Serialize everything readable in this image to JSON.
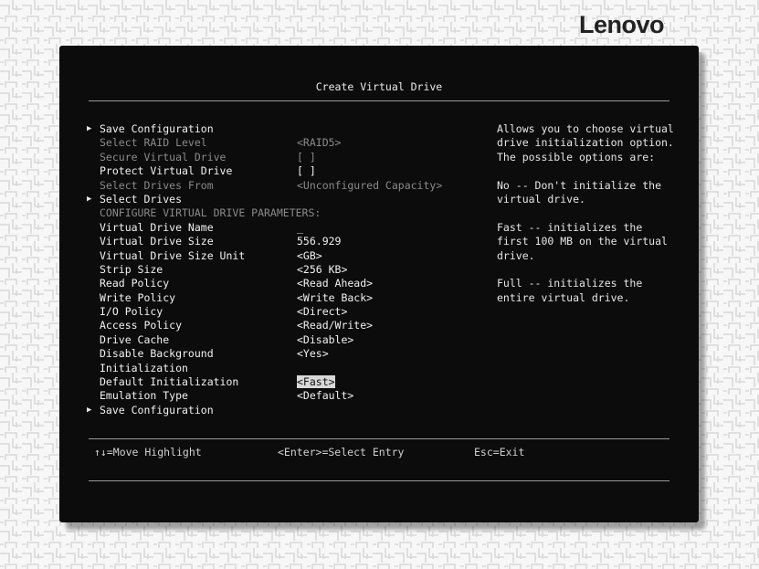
{
  "brand": "Lenovo",
  "title": "Create Virtual Drive",
  "rows": [
    {
      "label": "Save Configuration",
      "value": "",
      "arrow": true,
      "style": "bright"
    },
    {
      "label": "Select RAID Level",
      "value": "<RAID5>",
      "style": "dim"
    },
    {
      "label": "Secure Virtual Drive",
      "value": "[ ]",
      "style": "dim"
    },
    {
      "label": "Protect Virtual Drive",
      "value": "[ ]",
      "style": "bright"
    },
    {
      "label": "Select Drives From",
      "value": "<Unconfigured Capacity>",
      "style": "dim"
    },
    {
      "label": "Select Drives",
      "value": "",
      "arrow": true,
      "style": "bright"
    },
    {
      "label": "CONFIGURE VIRTUAL DRIVE PARAMETERS:",
      "value": "",
      "style": "dim"
    },
    {
      "label": "Virtual Drive Name",
      "value": "_",
      "style": "bright"
    },
    {
      "label": "Virtual Drive Size",
      "value": "556.929",
      "style": "bright"
    },
    {
      "label": "Virtual Drive Size Unit",
      "value": "<GB>",
      "style": "bright"
    },
    {
      "label": "Strip Size",
      "value": "<256 KB>",
      "style": "bright"
    },
    {
      "label": "Read Policy",
      "value": "<Read Ahead>",
      "style": "bright"
    },
    {
      "label": "Write Policy",
      "value": "<Write Back>",
      "style": "bright"
    },
    {
      "label": "I/O Policy",
      "value": "<Direct>",
      "style": "bright"
    },
    {
      "label": "Access Policy",
      "value": "<Read/Write>",
      "style": "bright"
    },
    {
      "label": "Drive Cache",
      "value": "<Disable>",
      "style": "bright"
    },
    {
      "label": "Disable Background",
      "value": "<Yes>",
      "style": "bright"
    },
    {
      "label": "Initialization",
      "value": "",
      "style": "bright"
    },
    {
      "label": "Default Initialization",
      "value": "<Fast>",
      "style": "bright",
      "highlight": true
    },
    {
      "label": "Emulation Type",
      "value": "<Default>",
      "style": "bright"
    },
    {
      "label": "Save Configuration",
      "value": "",
      "arrow": true,
      "style": "bright"
    }
  ],
  "help": [
    "Allows you to choose virtual",
    "drive initialization option.",
    "The possible options are:",
    "",
    "No -- Don't initialize the",
    "virtual drive.",
    "",
    "Fast -- initializes the",
    "first 100 MB on the virtual",
    "drive.",
    "",
    "Full -- initializes the",
    "entire virtual drive."
  ],
  "footer": {
    "move": "↑↓=Move Highlight",
    "select": "<Enter>=Select Entry",
    "exit": "Esc=Exit"
  }
}
